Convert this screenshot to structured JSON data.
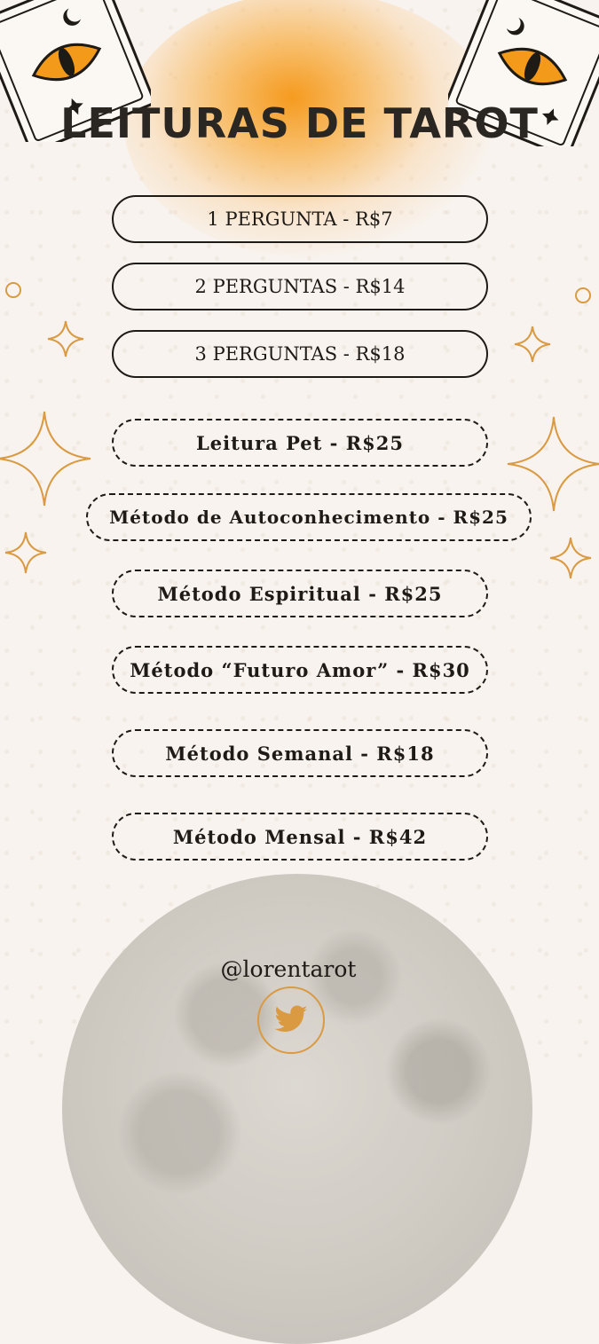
{
  "title": "LEITURAS DE TAROT",
  "questions": [
    {
      "label": "1 PERGUNTA - R$7"
    },
    {
      "label": "2 PERGUNTAS - R$14"
    },
    {
      "label": "3 PERGUNTAS - R$18"
    }
  ],
  "methods": [
    {
      "label": "Leitura Pet - R$25"
    },
    {
      "label": "Método de Autoconhecimento - R$25"
    },
    {
      "label": "Método Espiritual - R$25"
    },
    {
      "label": "Método “Futuro Amor” - R$30"
    },
    {
      "label": "Método Semanal - R$18"
    },
    {
      "label": "Método Mensal - R$42"
    }
  ],
  "handle": "@lorentarot",
  "icons": [
    "eye-card-icon",
    "sparkle-icon",
    "circle-icon",
    "moon-icon",
    "twitter-icon"
  ],
  "colors": {
    "accent": "#f5961a",
    "gold": "#d99a42",
    "text": "#1e1a16",
    "background": "#f8f3ee"
  }
}
